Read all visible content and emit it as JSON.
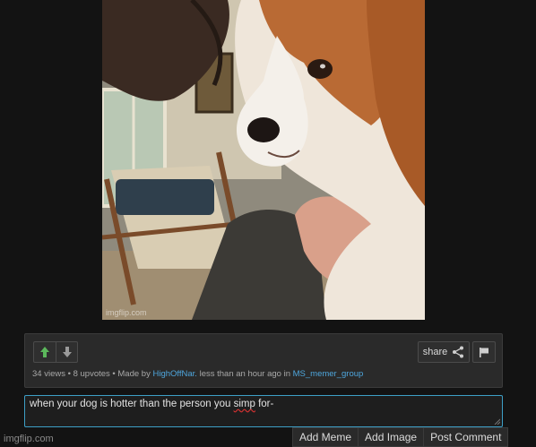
{
  "image": {
    "watermark": "imgflip.com"
  },
  "info": {
    "views": "34 views",
    "sep1": " • ",
    "upvotes": "8 upvotes",
    "sep2": " • Made by ",
    "author": "HighOffNar.",
    "time": " less than an hour ago in ",
    "stream": "MS_memer_group",
    "share_label": "share",
    "upvote_icon": "arrow-up-icon",
    "downvote_icon": "arrow-down-icon",
    "accent_up": "#5cb85c",
    "link_color": "#4ea6dd"
  },
  "comment": {
    "text_before": "when your dog is hotter than the person you ",
    "text_spell": "simp",
    "text_after": " for-",
    "border_color": "#3d9fc6"
  },
  "actions": {
    "add_meme": "Add Meme",
    "add_image": "Add Image",
    "post_comment": "Post Comment"
  },
  "footer": {
    "site": "imgflip.com"
  }
}
